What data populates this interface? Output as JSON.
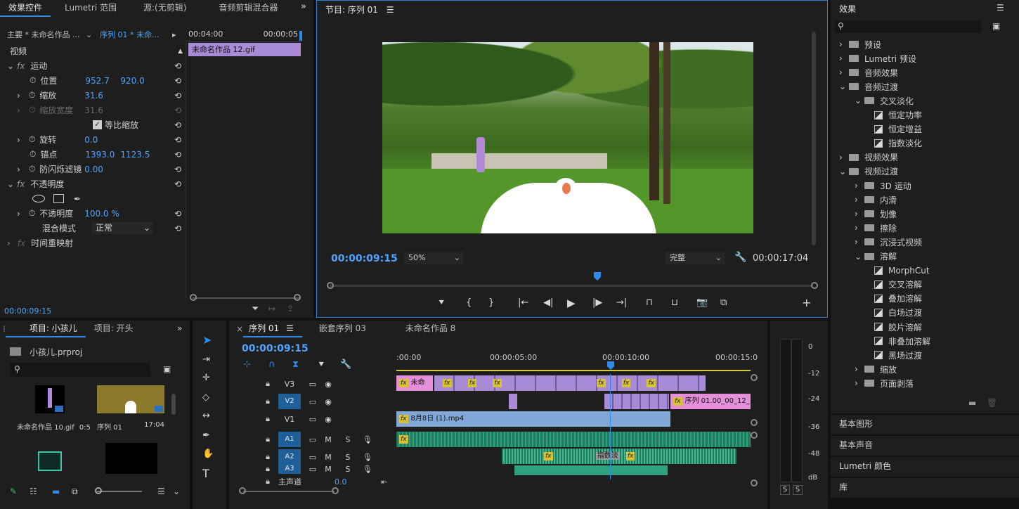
{
  "effect_controls": {
    "tabs": [
      "效果控件",
      "Lumetri 范围",
      "源:(无剪辑)",
      "音频剪辑混合器"
    ],
    "master": "主要 * 未命名作品 ...",
    "sequence": "序列 01 * 未命...",
    "ruler_start": "00:04:00",
    "ruler_end": "00:00:05",
    "clip_name": "未命名作品 12.gif",
    "section_video": "视频",
    "motion": "运动",
    "position_label": "位置",
    "position_x": "952.7",
    "position_y": "920.0",
    "scale_label": "缩放",
    "scale_value": "31.6",
    "scale_width_label": "缩放宽度",
    "scale_width_value": "31.6",
    "uniform_scale_label": "等比缩放",
    "rotation_label": "旋转",
    "rotation_value": "0.0",
    "anchor_label": "锚点",
    "anchor_x": "1393.0",
    "anchor_y": "1123.5",
    "flicker_label": "防闪烁滤镜",
    "flicker_value": "0.00",
    "opacity_section": "不透明度",
    "opacity_label": "不透明度",
    "opacity_value": "100.0 %",
    "blend_label": "混合模式",
    "blend_value": "正常",
    "time_remap": "时间重映射",
    "timecode": "00:00:09:15"
  },
  "program": {
    "title": "节目: 序列 01",
    "timecode": "00:00:09:15",
    "zoom": "50%",
    "quality": "完整",
    "duration": "00:00:17:04"
  },
  "project": {
    "tabs": [
      "项目: 小孩儿",
      "项目: 开头"
    ],
    "file": "小孩儿.prproj",
    "items": [
      {
        "name": "未命名作品 10.gif",
        "dur": "0:5"
      },
      {
        "name": "序列 01",
        "dur": "17:04"
      }
    ]
  },
  "timeline": {
    "tabs": [
      "序列 01",
      "嵌套序列 03",
      "未命名作品 8"
    ],
    "timecode": "00:00:09:15",
    "ruler": [
      ":00:00",
      "00:00:05:00",
      "00:00:10:00",
      "00:00:15:0"
    ],
    "tracks": [
      "V3",
      "V2",
      "V1",
      "A1",
      "A2",
      "A3"
    ],
    "master_label": "主声道",
    "master_value": "0.0",
    "v1_clip": "8月8日 (1).mp4",
    "v2_clip": "序列 01.00_00_12_",
    "v3_clip": "未命",
    "a2_clip": "指数淡",
    "m_label": "M",
    "s_label": "S"
  },
  "meter": {
    "scale": [
      "0",
      "-12",
      "-24",
      "-36",
      "-48",
      "dB"
    ],
    "solo": [
      "S",
      "S"
    ]
  },
  "effects": {
    "title": "效果",
    "tree": [
      {
        "label": "预设",
        "depth": 0,
        "kind": "folder",
        "open": false
      },
      {
        "label": "Lumetri 预设",
        "depth": 0,
        "kind": "folder",
        "open": false
      },
      {
        "label": "音频效果",
        "depth": 0,
        "kind": "folder",
        "open": false
      },
      {
        "label": "音频过渡",
        "depth": 0,
        "kind": "folder",
        "open": true
      },
      {
        "label": "交叉淡化",
        "depth": 1,
        "kind": "folder",
        "open": true
      },
      {
        "label": "恒定功率",
        "depth": 2,
        "kind": "item"
      },
      {
        "label": "恒定增益",
        "depth": 2,
        "kind": "item"
      },
      {
        "label": "指数淡化",
        "depth": 2,
        "kind": "item"
      },
      {
        "label": "视频效果",
        "depth": 0,
        "kind": "folder",
        "open": false
      },
      {
        "label": "视频过渡",
        "depth": 0,
        "kind": "folder",
        "open": true
      },
      {
        "label": "3D 运动",
        "depth": 1,
        "kind": "folder",
        "open": false
      },
      {
        "label": "内滑",
        "depth": 1,
        "kind": "folder",
        "open": false
      },
      {
        "label": "划像",
        "depth": 1,
        "kind": "folder",
        "open": false
      },
      {
        "label": "擦除",
        "depth": 1,
        "kind": "folder",
        "open": false
      },
      {
        "label": "沉浸式视频",
        "depth": 1,
        "kind": "folder",
        "open": false
      },
      {
        "label": "溶解",
        "depth": 1,
        "kind": "folder",
        "open": true
      },
      {
        "label": "MorphCut",
        "depth": 2,
        "kind": "item"
      },
      {
        "label": "交叉溶解",
        "depth": 2,
        "kind": "item"
      },
      {
        "label": "叠加溶解",
        "depth": 2,
        "kind": "item"
      },
      {
        "label": "白场过渡",
        "depth": 2,
        "kind": "item"
      },
      {
        "label": "胶片溶解",
        "depth": 2,
        "kind": "item"
      },
      {
        "label": "非叠加溶解",
        "depth": 2,
        "kind": "item"
      },
      {
        "label": "黑场过渡",
        "depth": 2,
        "kind": "item"
      },
      {
        "label": "缩放",
        "depth": 1,
        "kind": "folder",
        "open": false
      },
      {
        "label": "页面剥落",
        "depth": 1,
        "kind": "folder",
        "open": false
      }
    ],
    "sections": [
      "基本图形",
      "基本声音",
      "Lumetri 颜色",
      "库"
    ]
  }
}
